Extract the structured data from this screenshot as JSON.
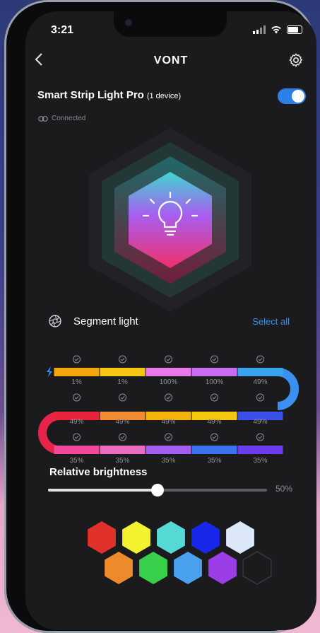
{
  "status_bar": {
    "time": "3:21"
  },
  "header": {
    "brand": "VONT",
    "back_icon": "chevron-left-icon",
    "settings_icon": "gear-icon"
  },
  "device": {
    "name": "Smart Strip Light Pro",
    "count": "(1 device)",
    "power_on": true,
    "connection": "Connected"
  },
  "segment": {
    "title": "Segment light",
    "select_all": "Select all",
    "rows": [
      {
        "segments": [
          {
            "color": "#f2a50c",
            "percent": "1%"
          },
          {
            "color": "#f5c516",
            "percent": "1%"
          },
          {
            "color": "#e879e6",
            "percent": "100%"
          },
          {
            "color": "#c76df0",
            "percent": "100%"
          },
          {
            "color": "#39a3f0",
            "percent": "49%"
          }
        ]
      },
      {
        "segments": [
          {
            "color": "#e8243a",
            "percent": "49%"
          },
          {
            "color": "#f28a32",
            "percent": "49%"
          },
          {
            "color": "#f5b40a",
            "percent": "49%"
          },
          {
            "color": "#f5c80f",
            "percent": "49%"
          },
          {
            "color": "#3b50e8",
            "percent": "49%"
          }
        ]
      },
      {
        "segments": [
          {
            "color": "#f2479a",
            "percent": "35%"
          },
          {
            "color": "#ea6bc0",
            "percent": "35%"
          },
          {
            "color": "#a55cf0",
            "percent": "35%"
          },
          {
            "color": "#3b72ee",
            "percent": "35%"
          },
          {
            "color": "#6b3cf0",
            "percent": "35%"
          }
        ]
      }
    ]
  },
  "brightness": {
    "label": "Relative brightness",
    "value_text": "50%",
    "level": 0.5
  },
  "palette": {
    "row1": [
      "#e2302a",
      "#f3f22e",
      "#55d9d4",
      "#1828e8",
      "#dce8f7"
    ],
    "row2": [
      "#ec8a2c",
      "#38d04a",
      "#4aa2ee",
      "#9b3ee8",
      "empty"
    ]
  }
}
